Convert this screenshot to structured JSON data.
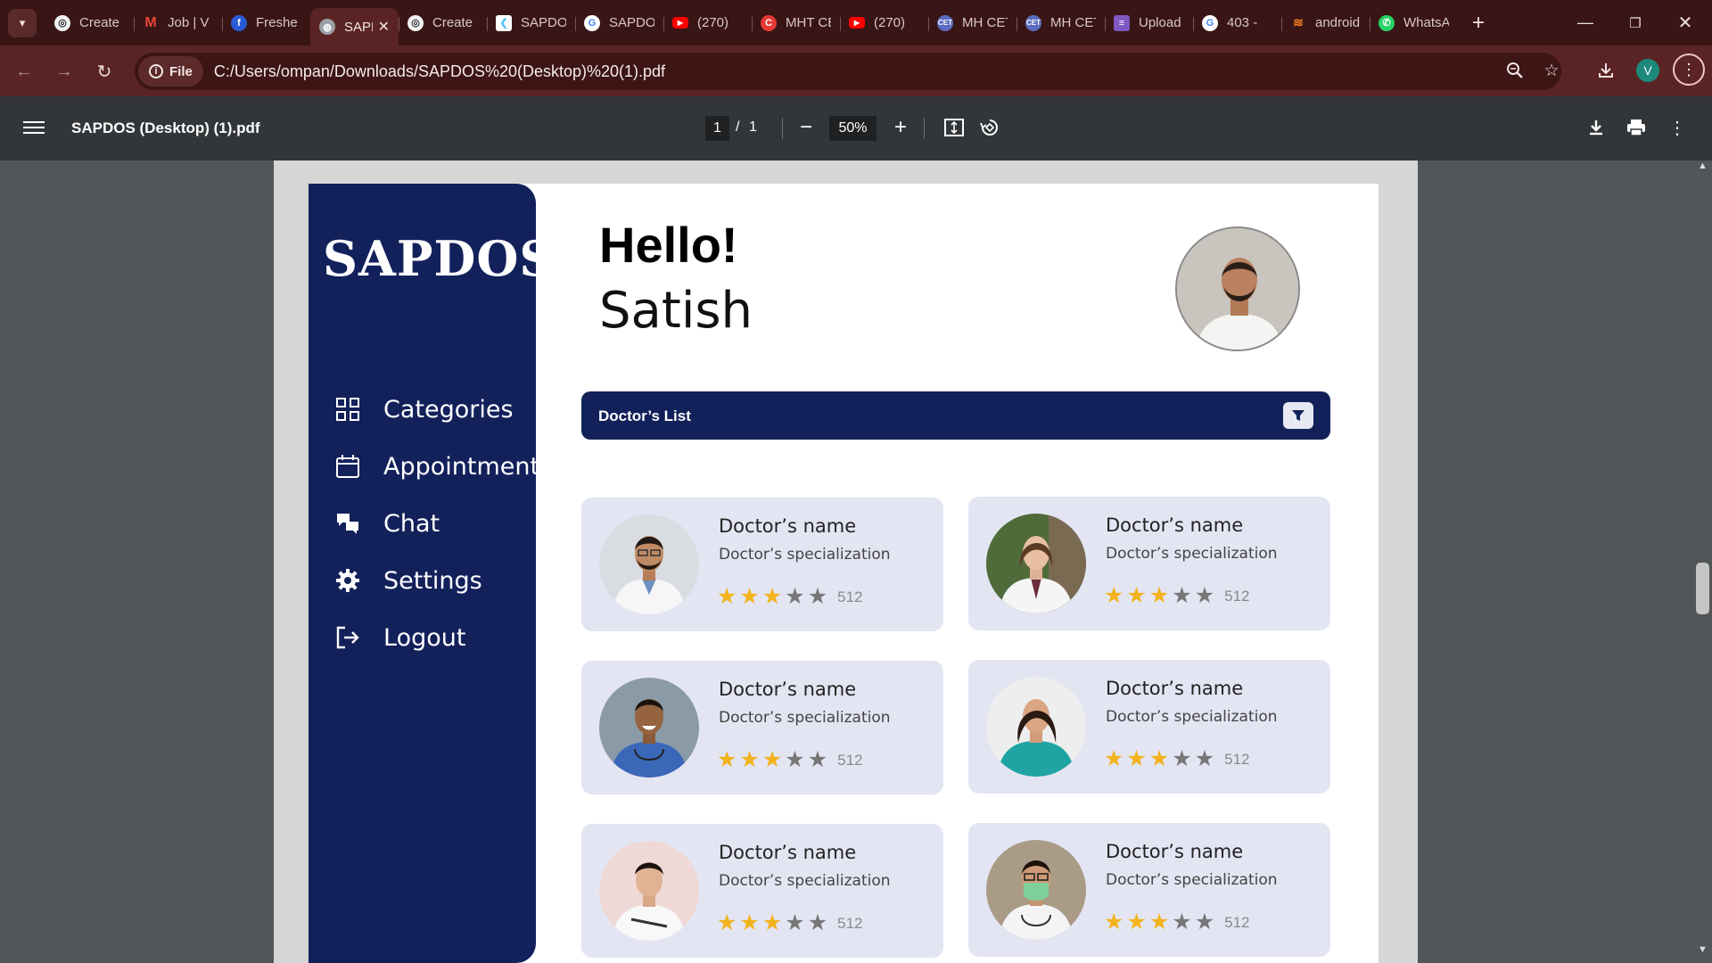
{
  "browser": {
    "tabs": [
      {
        "label": "Create",
        "icon": "chatgpt-icon",
        "color": "#e8e8e8"
      },
      {
        "label": "Job | V",
        "icon": "gmail-icon",
        "color": "#ea4335"
      },
      {
        "label": "Freshe",
        "icon": "freshersworld-icon",
        "color": "#2a5bd7"
      },
      {
        "label": "SAPDOS",
        "icon": "chrome-globe-icon",
        "color": "#9aa0a6",
        "active": true
      },
      {
        "label": "Create",
        "icon": "chatgpt-icon",
        "color": "#e8e8e8"
      },
      {
        "label": "SAPDOS",
        "icon": "flutter-icon",
        "color": "#4fc3f7"
      },
      {
        "label": "SAPDOS",
        "icon": "google-icon",
        "color": "#e8e8e8"
      },
      {
        "label": "(270)",
        "icon": "youtube-icon",
        "color": "#ff0000"
      },
      {
        "label": "MHT CET",
        "icon": "mht-icon",
        "color": "#e53935"
      },
      {
        "label": "(270)",
        "icon": "youtube-icon",
        "color": "#ff0000"
      },
      {
        "label": "MH CET",
        "icon": "cet-icon",
        "color": "#5c6bc0"
      },
      {
        "label": "MH CET",
        "icon": "cet-icon",
        "color": "#5c6bc0"
      },
      {
        "label": "Upload",
        "icon": "forms-icon",
        "color": "#7e57c2"
      },
      {
        "label": "403 -",
        "icon": "google-icon",
        "color": "#e8e8e8"
      },
      {
        "label": "android",
        "icon": "stackoverflow-icon",
        "color": "#f48024"
      },
      {
        "label": "WhatsApp",
        "icon": "whatsapp-icon",
        "color": "#25d366"
      }
    ],
    "new_tab_label": "+",
    "omnibox": {
      "chip_label": "File",
      "url": "C:/Users/ompan/Downloads/SAPDOS%20(Desktop)%20(1).pdf"
    },
    "profile_initial": "V"
  },
  "pdf_viewer": {
    "title": "SAPDOS (Desktop) (1).pdf",
    "page_current": "1",
    "page_separator": "/",
    "page_total": "1",
    "zoom": "50%"
  },
  "app": {
    "brand": "SAPDOS",
    "nav": [
      {
        "label": "Categories",
        "icon": "grid-icon"
      },
      {
        "label": "Appointment",
        "icon": "calendar-icon"
      },
      {
        "label": "Chat",
        "icon": "chat-icon"
      },
      {
        "label": "Settings",
        "icon": "gear-icon"
      },
      {
        "label": "Logout",
        "icon": "logout-icon"
      }
    ],
    "greeting": "Hello!",
    "user_name": "Satish",
    "list_title": "Doctor’s List",
    "doctors": [
      {
        "name": "Doctor’s name",
        "specialization": "Doctor’s specialization",
        "rating": 3,
        "reviews": "512"
      },
      {
        "name": "Doctor’s name",
        "specialization": "Doctor’s specialization",
        "rating": 3,
        "reviews": "512"
      },
      {
        "name": "Doctor’s name",
        "specialization": "Doctor’s specialization",
        "rating": 3,
        "reviews": "512"
      },
      {
        "name": "Doctor’s name",
        "specialization": "Doctor’s specialization",
        "rating": 3,
        "reviews": "512"
      },
      {
        "name": "Doctor’s name",
        "specialization": "Doctor’s specialization",
        "rating": 3,
        "reviews": "512"
      },
      {
        "name": "Doctor’s name",
        "specialization": "Doctor’s specialization",
        "rating": 3,
        "reviews": "512"
      }
    ],
    "colors": {
      "sidebar": "#13215b",
      "card": "#e3e5f3",
      "star_on": "#f2b31d",
      "star_off": "#777777"
    }
  }
}
